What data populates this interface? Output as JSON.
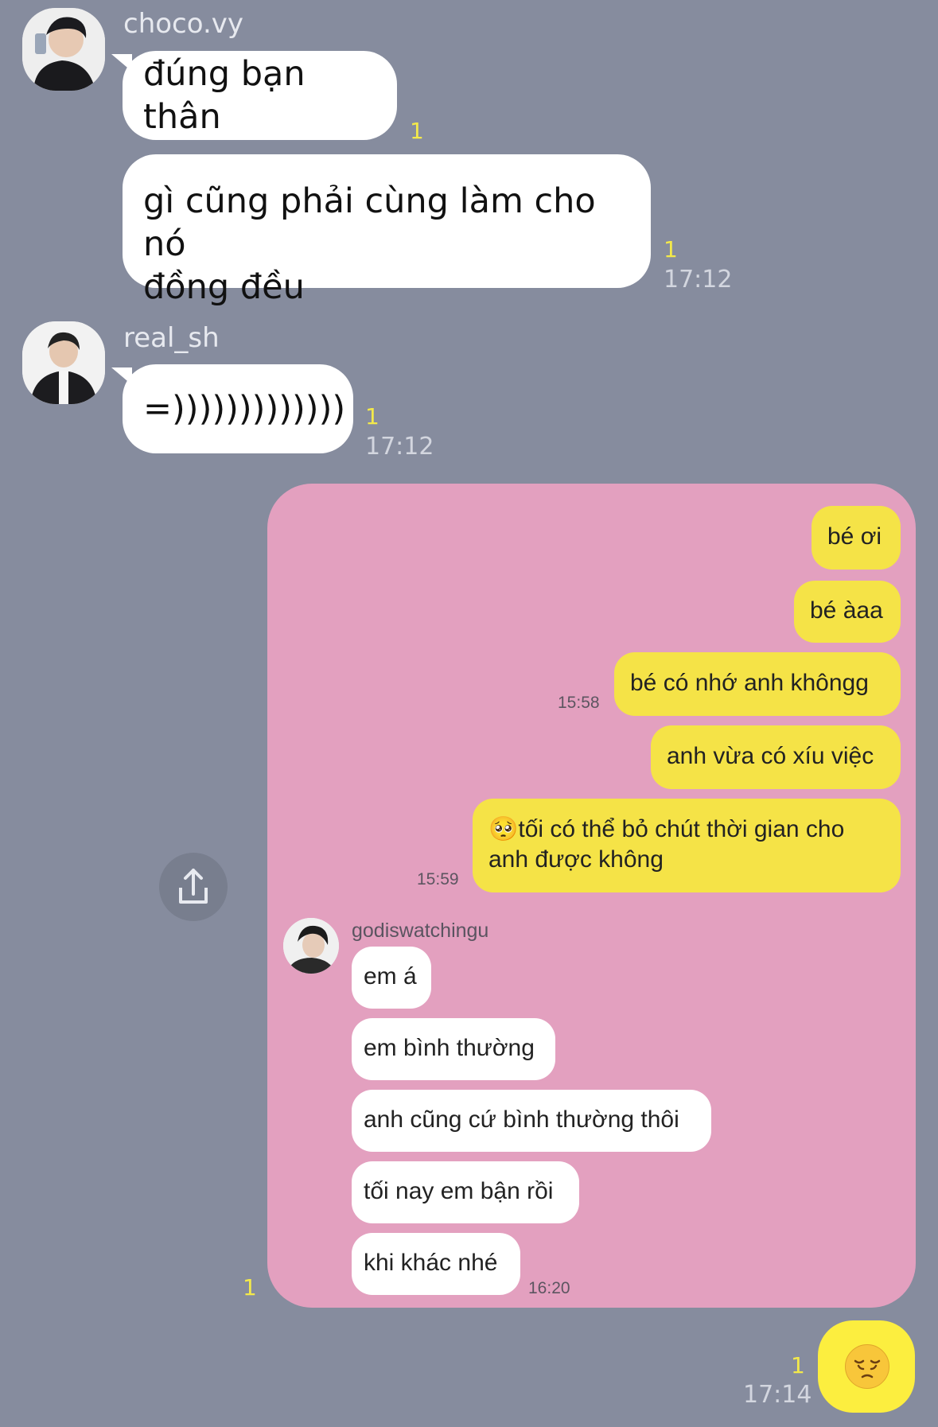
{
  "chat": {
    "messages": [
      {
        "sender": "choco.vy",
        "text": "đúng bạn thân",
        "unread": "1"
      },
      {
        "sender": "choco.vy",
        "text_line1": "gì cũng phải cùng làm cho nó",
        "text_line2": "đồng đều",
        "unread": "1",
        "time": "17:12"
      },
      {
        "sender": "real_sh",
        "text": "=)))))))))))))",
        "unread": "1",
        "time": "17:12"
      }
    ],
    "screenshot_card": {
      "outgoing": [
        {
          "text": "bé ơi"
        },
        {
          "text": "bé àaa"
        },
        {
          "text": "bé có nhớ anh khôngg",
          "time": "15:58"
        },
        {
          "text": "anh vừa có xíu việc"
        },
        {
          "emoji": "🥺",
          "text_line1": "tối có thể bỏ chút thời gian cho",
          "text_line2": "anh được không",
          "time": "15:59"
        }
      ],
      "reply_sender": "godiswatchingu",
      "incoming": [
        {
          "text": "em á"
        },
        {
          "text": "em bình thường"
        },
        {
          "text": "anh cũng cứ bình thường thôi"
        },
        {
          "text": "tối nay em bận rồi"
        },
        {
          "text": "khi khác nhé",
          "time": "16:20"
        }
      ],
      "unread": "1"
    },
    "last_message": {
      "emoji": "pensive-face",
      "unread": "1",
      "time": "17:14"
    }
  },
  "icons": {
    "share": "share-upload-icon"
  },
  "colors": {
    "background": "#868c9e",
    "card": "#e3a0bf",
    "outgoing_bubble": "#f5e347",
    "unread": "#f3e94a"
  }
}
